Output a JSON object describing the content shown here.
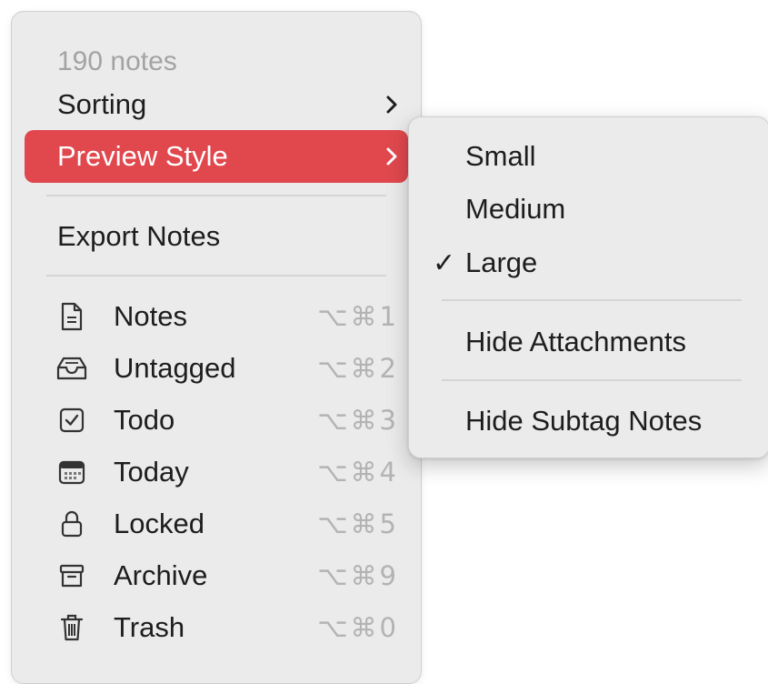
{
  "main_menu": {
    "note_count": "190 notes",
    "sorting_label": "Sorting",
    "preview_style_label": "Preview Style",
    "export_label": "Export Notes",
    "library": [
      {
        "label": "Notes",
        "icon": "document-icon",
        "shortcut": "⌥⌘1"
      },
      {
        "label": "Untagged",
        "icon": "inbox-tray-icon",
        "shortcut": "⌥⌘2"
      },
      {
        "label": "Todo",
        "icon": "checkbox-icon",
        "shortcut": "⌥⌘3"
      },
      {
        "label": "Today",
        "icon": "calendar-icon",
        "shortcut": "⌥⌘4"
      },
      {
        "label": "Locked",
        "icon": "lock-icon",
        "shortcut": "⌥⌘5"
      },
      {
        "label": "Archive",
        "icon": "archive-box-icon",
        "shortcut": "⌥⌘9"
      },
      {
        "label": "Trash",
        "icon": "trash-icon",
        "shortcut": "⌥⌘0"
      }
    ]
  },
  "submenu": {
    "small_label": "Small",
    "medium_label": "Medium",
    "large_label": "Large",
    "selected_mark": "✓",
    "hide_attachments_label": "Hide Attachments",
    "hide_subtag_notes_label": "Hide Subtag Notes"
  },
  "colors": {
    "highlight": "#e0484e",
    "menu_background": "#ebebeb",
    "shortcut_text": "#b3b3b3"
  }
}
